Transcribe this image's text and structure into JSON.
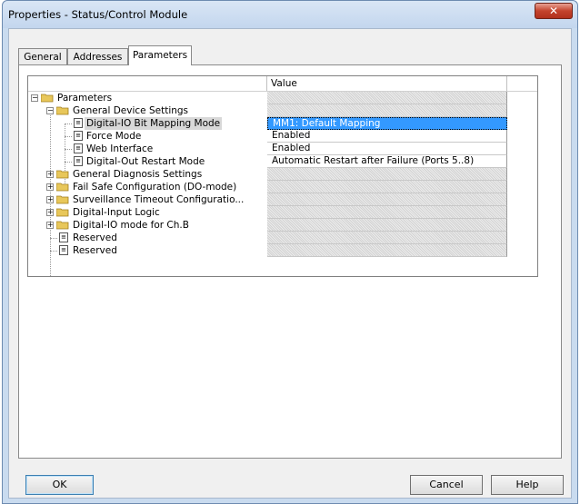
{
  "window": {
    "title": "Properties - Status/Control Module",
    "close_glyph": "✕"
  },
  "tabs": [
    {
      "label": "General"
    },
    {
      "label": "Addresses"
    },
    {
      "label": "Parameters"
    }
  ],
  "grid": {
    "header_value": "Value",
    "rows": [
      {
        "name": "Parameters",
        "value": ""
      },
      {
        "name": "General Device Settings",
        "value": ""
      },
      {
        "name": "Digital-IO Bit Mapping Mode",
        "value": "MM1: Default Mapping"
      },
      {
        "name": "Force Mode",
        "value": "Enabled"
      },
      {
        "name": "Web Interface",
        "value": "Enabled"
      },
      {
        "name": "Digital-Out Restart Mode",
        "value": "Automatic Restart after Failure (Ports 5..8)"
      },
      {
        "name": "General Diagnosis Settings",
        "value": ""
      },
      {
        "name": "Fail Safe Configuration (DO-mode)",
        "value": ""
      },
      {
        "name": "Surveillance Timeout Configuratio...",
        "value": ""
      },
      {
        "name": "Digital-Input Logic",
        "value": ""
      },
      {
        "name": "Digital-IO mode for Ch.B",
        "value": ""
      },
      {
        "name": "Reserved",
        "value": ""
      },
      {
        "name": "Reserved",
        "value": ""
      }
    ]
  },
  "buttons": {
    "ok": "OK",
    "cancel": "Cancel",
    "help": "Help"
  },
  "icons": {
    "expander_minus": "−",
    "expander_plus": "+",
    "param_glyph": "≡"
  },
  "colors": {
    "selection": "#3399ff",
    "title_close": "#c4432d",
    "folder": "#e8c75a"
  }
}
